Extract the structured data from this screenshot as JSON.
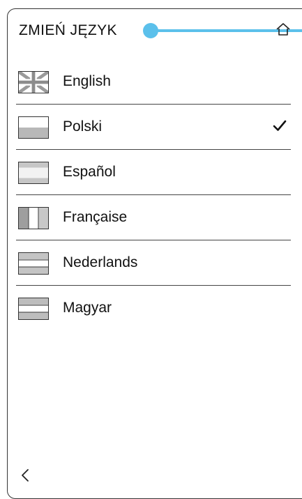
{
  "header": {
    "title": "ZMIEŃ JĘZYK",
    "home_icon": "home-icon"
  },
  "languages": [
    {
      "label": "English",
      "flag": "flag-uk-icon",
      "selected": false
    },
    {
      "label": "Polski",
      "flag": "flag-poland-icon",
      "selected": true
    },
    {
      "label": "Español",
      "flag": "flag-spain-icon",
      "selected": false
    },
    {
      "label": "Française",
      "flag": "flag-france-icon",
      "selected": false
    },
    {
      "label": "Nederlands",
      "flag": "flag-netherlands-icon",
      "selected": false
    },
    {
      "label": "Magyar",
      "flag": "flag-hungary-icon",
      "selected": false
    }
  ],
  "footer": {
    "back_icon": "chevron-left-icon"
  },
  "colors": {
    "annotation": "#5bc0eb",
    "flag_gray": "#b8b8b8",
    "border": "#444444"
  }
}
